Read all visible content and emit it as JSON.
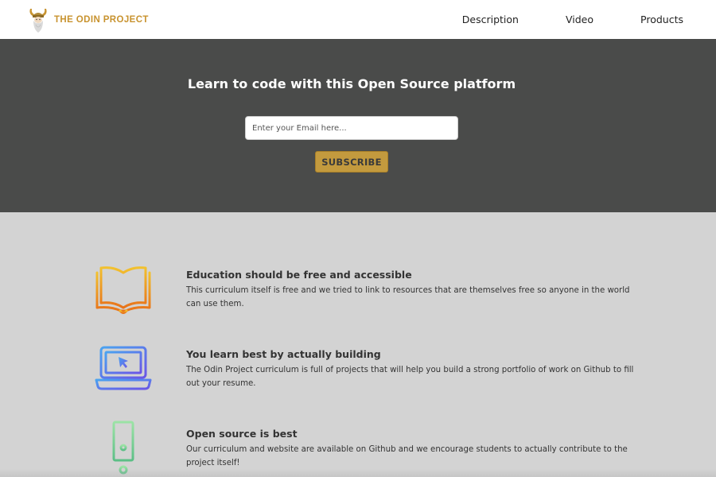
{
  "header": {
    "brand": "THE ODIN PROJECT",
    "nav": [
      "Description",
      "Video",
      "Products"
    ]
  },
  "hero": {
    "title": "Learn to code with this Open Source platform",
    "email_placeholder": "Enter your Email here...",
    "subscribe_label": "SUBSCRIBE"
  },
  "features": [
    {
      "icon": "open-book-icon",
      "title": "Education should be free and accessible",
      "body": "This curriculum itself is free and we tried to link to resources that are themselves free so anyone in the world can use them."
    },
    {
      "icon": "laptop-cursor-icon",
      "title": "You learn best by actually building",
      "body": "The Odin Project curriculum is full of projects that will help you build a strong portfolio of work on Github to fill out your resume."
    },
    {
      "icon": "server-network-icon",
      "title": "Open source is best",
      "body": "Our curriculum and website are available on Github and we encourage students to actually contribute to the project itself!"
    }
  ],
  "colors": {
    "brand_gold": "#c8932f",
    "hero_bg": "#4a4b4a",
    "page_bg": "#d3d3d3",
    "button_bg": "#c39a3e"
  }
}
